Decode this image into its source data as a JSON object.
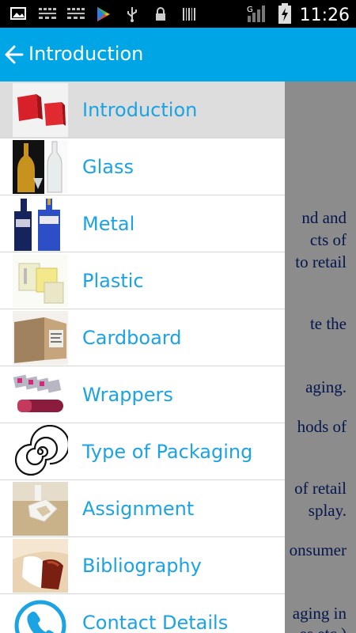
{
  "status_bar": {
    "time": "11:26",
    "icons": [
      "image-icon",
      "notification-icon",
      "notification-icon",
      "play-store-icon",
      "usb-icon",
      "lock-icon",
      "barcode-icon",
      "signal-icon",
      "battery-icon"
    ]
  },
  "app_bar": {
    "title": "Introduction",
    "back_icon": "arrow-back-icon",
    "color": "#00a5e6"
  },
  "drawer": {
    "accent_color": "#1ba3e3",
    "items": [
      {
        "label": "Introduction",
        "active": true,
        "icon": "red-boxes-image"
      },
      {
        "label": "Glass",
        "active": false,
        "icon": "glass-bottles-image"
      },
      {
        "label": "Metal",
        "active": false,
        "icon": "metal-bottles-image"
      },
      {
        "label": "Plastic",
        "active": false,
        "icon": "plastic-boxes-image"
      },
      {
        "label": "Cardboard",
        "active": false,
        "icon": "cardboard-box-image"
      },
      {
        "label": "Wrappers",
        "active": false,
        "icon": "wrappers-image"
      },
      {
        "label": "Type of Packaging",
        "active": false,
        "icon": "spiral-image"
      },
      {
        "label": "Assignment",
        "active": false,
        "icon": "assignment-image"
      },
      {
        "label": "Bibliography",
        "active": false,
        "icon": "bibliography-image"
      },
      {
        "label": "Contact Details",
        "active": false,
        "icon": "phone-icon"
      }
    ]
  },
  "background_text": [
    "nd and",
    "cts of",
    "to retail",
    "te the",
    "aging.",
    "hods of",
    "of retail",
    "splay.",
    "onsumer",
    "aging in",
    "es etc.)"
  ]
}
